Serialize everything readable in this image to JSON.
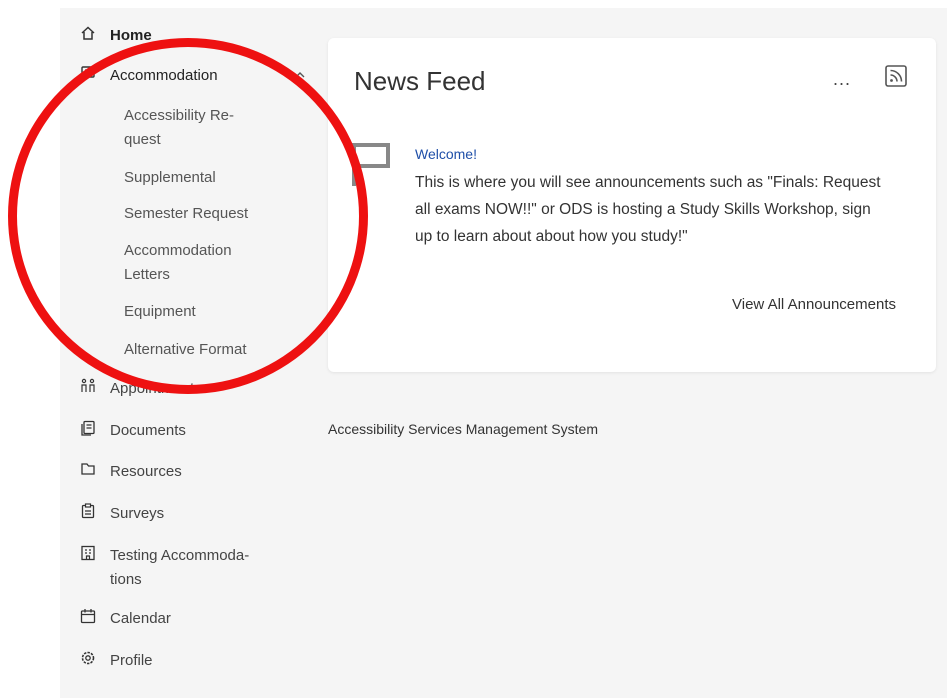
{
  "sidebar": {
    "home": "Home",
    "accommodation": "Accommodation",
    "sub_items": [
      "Accessibility Re-\nquest",
      "Supplemental",
      "Semester Request",
      "Accommodation\nLetters",
      "Equipment",
      "Alternative Format"
    ],
    "appointment": "Appointment",
    "documents": "Documents",
    "resources": "Resources",
    "surveys": "Surveys",
    "testing": "Testing Accommoda-\ntions",
    "calendar": "Calendar",
    "profile": "Profile"
  },
  "news_feed": {
    "title": "News Feed",
    "more_label": "...",
    "announcement_title": "Welcome!",
    "announcement_body": "This is where you will see announcements such as \"Finals: Request all exams NOW!!\" or ODS is hosting a Study Skills Workshop, sign up to learn about about how you study!\"",
    "view_all": "View All Announcements"
  },
  "footer": {
    "text": "Accessibility Services Management System"
  },
  "colors": {
    "annotation_circle": "#ee1111",
    "link": "#1f4fa8",
    "background": "#f5f5f5"
  },
  "icons": [
    "home-icon",
    "accommodation-icon",
    "chevron-up-icon",
    "appointment-icon",
    "documents-icon",
    "resources-icon",
    "surveys-icon",
    "testing-icon",
    "calendar-icon",
    "profile-icon",
    "more-icon",
    "rss-icon",
    "flag-icon"
  ]
}
